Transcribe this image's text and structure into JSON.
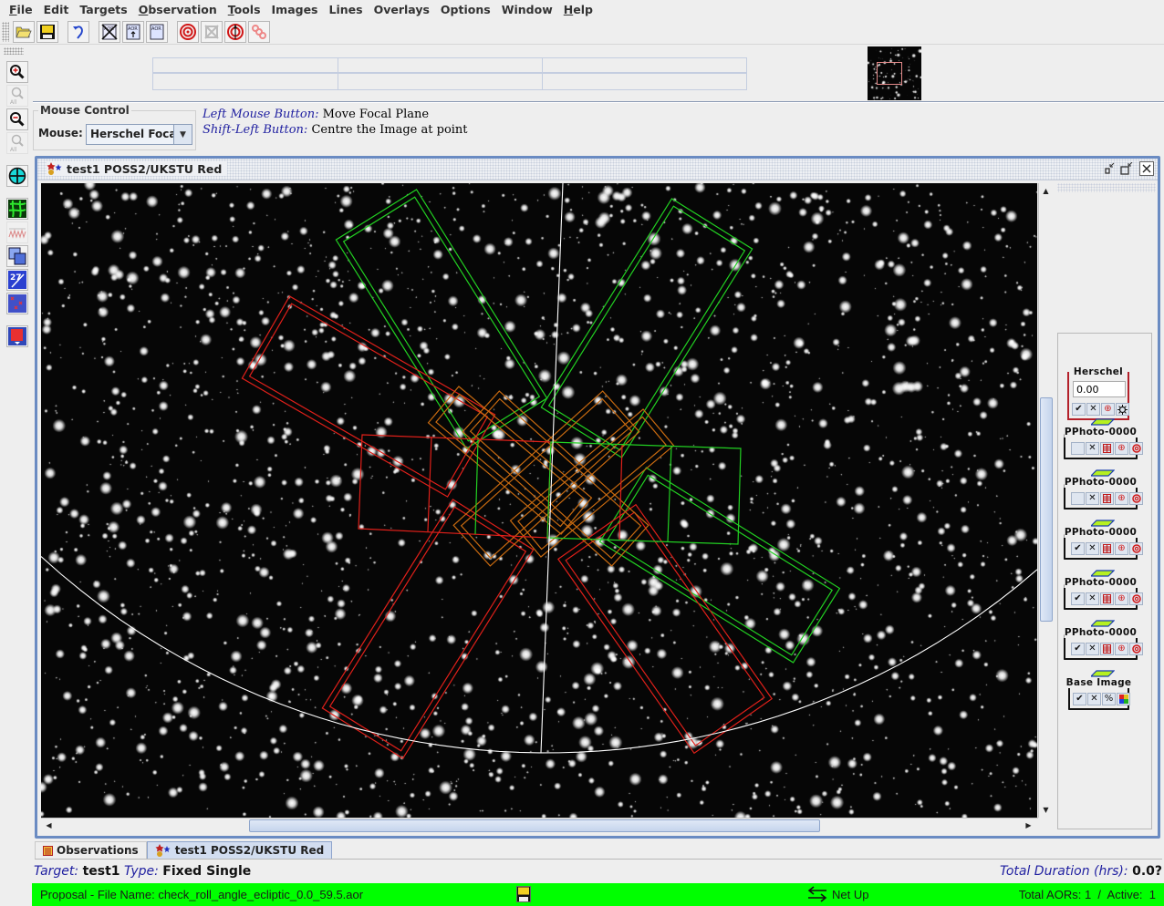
{
  "menubar": [
    {
      "label": "File",
      "mnemonic": "F",
      "rest": "ile"
    },
    {
      "label": "Edit",
      "mnemonic": "",
      "rest": "Edit"
    },
    {
      "label": "Targets",
      "mnemonic": "",
      "rest": "Targets"
    },
    {
      "label": "Observation",
      "mnemonic": "O",
      "rest": "bservation"
    },
    {
      "label": "Tools",
      "mnemonic": "T",
      "rest": "ools"
    },
    {
      "label": "Images",
      "mnemonic": "",
      "rest": "Images"
    },
    {
      "label": "Lines",
      "mnemonic": "",
      "rest": "Lines"
    },
    {
      "label": "Overlays",
      "mnemonic": "",
      "rest": "Overlays"
    },
    {
      "label": "Options",
      "mnemonic": "",
      "rest": "Options"
    },
    {
      "label": "Window",
      "mnemonic": "",
      "rest": "Window"
    },
    {
      "label": "Help",
      "mnemonic": "H",
      "rest": "elp"
    }
  ],
  "toolbar": {
    "buttons": [
      "open-folder-icon",
      "save-disk-icon",
      "undo-icon",
      "delete-aor-icon",
      "new-aor-icon",
      "edit-aor-icon",
      "target-icon",
      "target-disabled-icon",
      "target-north-icon",
      "chain-link-icon"
    ],
    "aor_label": "AOR"
  },
  "left_toolbar": {
    "zoom_all_label": "All"
  },
  "mouse_control": {
    "title": "Mouse Control",
    "label": "Mouse:",
    "selected": "Herschel Focal"
  },
  "hints": [
    {
      "key": "Left Mouse Button:",
      "value": "Move Focal Plane"
    },
    {
      "key": "Shift-Left Button:",
      "value": "Centre the Image at point"
    }
  ],
  "frame": {
    "title": "test1  POSS2/UKSTU Red"
  },
  "layers": {
    "herschel": {
      "name": "Herschel",
      "value": "0.00"
    },
    "pphoto": [
      {
        "name": "PPhoto-0000",
        "visible": false
      },
      {
        "name": "PPhoto-0000",
        "visible": false
      },
      {
        "name": "PPhoto-0000",
        "visible": true
      },
      {
        "name": "PPhoto-0000",
        "visible": true
      },
      {
        "name": "PPhoto-0000",
        "visible": true
      }
    ],
    "base": {
      "name": "Base Image",
      "visible": true
    },
    "glyphs": {
      "check": "✔",
      "close": "✕",
      "plus": "⊕",
      "percent": "%"
    }
  },
  "scroll": {
    "vertical_fraction_start": 0.33,
    "vertical_fraction_visible": 0.37,
    "horizontal_fraction_start": 0.2,
    "horizontal_fraction_visible": 0.59
  },
  "overlay_colors": {
    "red": "#e0201a",
    "green": "#22d022",
    "orange": "#c86a10",
    "white": "#ffffff"
  },
  "tabs": [
    {
      "label": "Observations",
      "icon": "table-icon",
      "active": false
    },
    {
      "label": "test1  POSS2/UKSTU Red",
      "icon": "sky-target-icon",
      "active": true
    }
  ],
  "target_info": {
    "target_key": "Target:",
    "target_value": "test1",
    "type_key": "Type:",
    "type_value": "Fixed Single",
    "duration_key": "Total Duration (hrs):",
    "duration_value": "0.0?"
  },
  "statusbar": {
    "file": "Proposal - File Name: check_roll_angle_ecliptic_0.0_59.5.aor",
    "net": "Net Up",
    "totals": "Total AORs: 1  /  Active:  1",
    "color": "#00ff00"
  }
}
